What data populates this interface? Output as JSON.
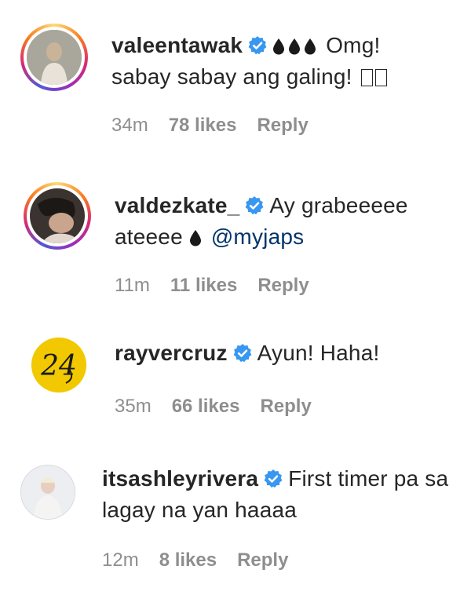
{
  "comments": [
    {
      "username": "valeentawak",
      "text_after_drops": "Omg!",
      "text_line2": "sabay sabay ang galing!",
      "time": "34m",
      "likes": "78 likes",
      "reply": "Reply"
    },
    {
      "username": "valdezkate_",
      "text_line1": "Ay grabeeeee",
      "text_line2_prefix": "ateeee",
      "mention": "@myjaps",
      "time": "11m",
      "likes": "11 likes",
      "reply": "Reply"
    },
    {
      "username": "rayvercruz",
      "text": "Ayun! Haha!",
      "time": "35m",
      "likes": "66 likes",
      "reply": "Reply"
    },
    {
      "username": "itsashleyrivera",
      "text_line1": "First timer pa sa",
      "text_line2": "lagay na yan haaaa",
      "time": "12m",
      "likes": "8 likes",
      "reply": "Reply"
    }
  ],
  "colors": {
    "verified_badge": "#3897f0",
    "mention": "#003569",
    "meta": "#8e8e8e"
  },
  "icons": {
    "verified": "verified-badge-icon",
    "drop": "drop-emoji-icon",
    "missing_glyph": "missing-glyph-box"
  }
}
